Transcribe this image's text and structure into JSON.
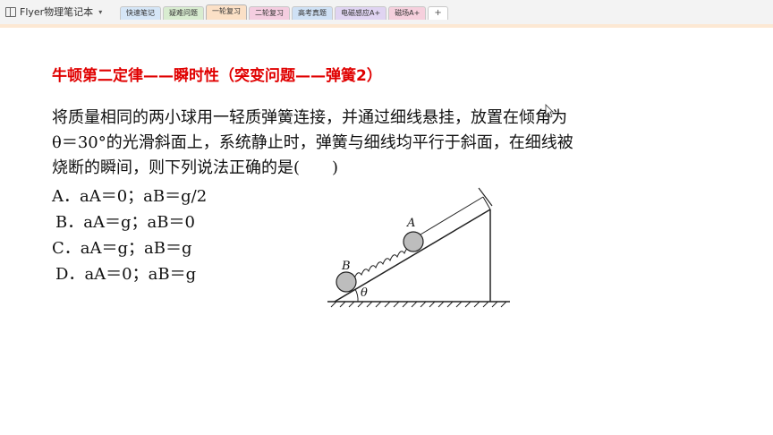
{
  "app": {
    "title": "Flyer物理笔记本",
    "menu_caret": "▾"
  },
  "tabs": [
    {
      "label": "快速笔记",
      "color": "#d5e6f7",
      "active": false
    },
    {
      "label": "疑难问题",
      "color": "#d8ecd0",
      "active": false
    },
    {
      "label": "一轮复习",
      "color": "#fbe0c6",
      "active": true
    },
    {
      "label": "二轮复习",
      "color": "#f4cde0",
      "active": false
    },
    {
      "label": "高考真题",
      "color": "#cfe1f5",
      "active": false
    },
    {
      "label": "电磁感应A+",
      "color": "#e0d4f2",
      "active": false
    },
    {
      "label": "磁场A+",
      "color": "#f6d0dd",
      "active": false
    }
  ],
  "add_tab_label": "+",
  "content": {
    "heading": "牛顿第二定律——瞬时性（突变问题——弹簧2）",
    "question_lines": [
      "将质量相同的两小球用一轻质弹簧连接，并通过细线悬挂，放置在倾角为",
      "θ＝30°的光滑斜面上，系统静止时，弹簧与细线均平行于斜面，在细线被",
      "烧断的瞬间，则下列说法正确的是(　　)"
    ],
    "options": [
      {
        "letter": "A．",
        "text": "aA＝0；aB＝g/2"
      },
      {
        "letter": "B．",
        "text": "aA＝g；aB＝0"
      },
      {
        "letter": "C．",
        "text": "aA＝g；aB＝g"
      },
      {
        "letter": "D．",
        "text": "aA＝0；aB＝g"
      }
    ],
    "diagram": {
      "label_a": "A",
      "label_b": "B",
      "label_theta": "θ"
    }
  }
}
